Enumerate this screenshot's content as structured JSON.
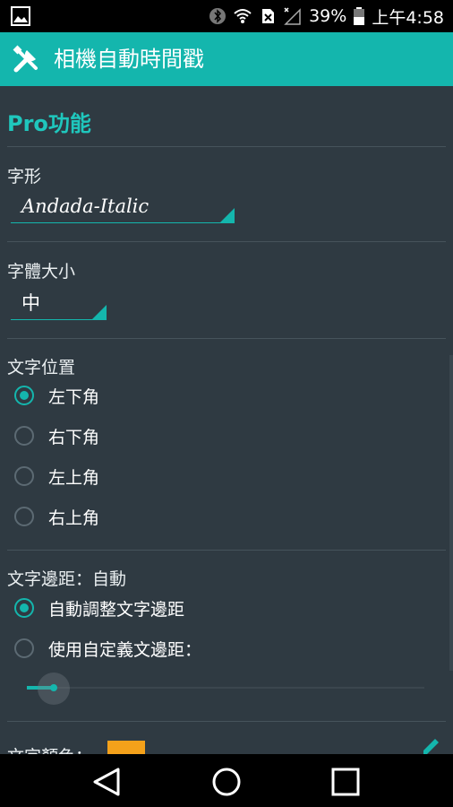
{
  "status_bar": {
    "battery_percent": "39%",
    "time": "上午4:58",
    "icons": [
      "image-icon",
      "bluetooth-icon",
      "wifi-icon",
      "no-sim-icon",
      "signal-icon",
      "battery-icon"
    ]
  },
  "app_bar": {
    "title": "相機自動時間戳",
    "icon": "wrench-screwdriver-icon",
    "accent_color": "#14b6ad"
  },
  "section": {
    "title": "Pro功能"
  },
  "font": {
    "label": "字形",
    "value": "Andada-Italic"
  },
  "font_size": {
    "label": "字體大小",
    "value": "中"
  },
  "text_position": {
    "label": "文字位置",
    "options": [
      {
        "label": "左下角",
        "checked": true
      },
      {
        "label": "右下角",
        "checked": false
      },
      {
        "label": "左上角",
        "checked": false
      },
      {
        "label": "右上角",
        "checked": false
      }
    ]
  },
  "text_margin": {
    "label": "文字邊距：自動",
    "options": [
      {
        "label": "自動調整文字邊距",
        "checked": true
      },
      {
        "label": "使用自定義文邊距：",
        "checked": false
      }
    ],
    "slider_value": 0.05
  },
  "text_color": {
    "label": "文字顏色：",
    "swatch": "#f4a11a"
  },
  "nav_bar": {
    "buttons": [
      "back-icon",
      "home-icon",
      "recents-icon"
    ]
  }
}
